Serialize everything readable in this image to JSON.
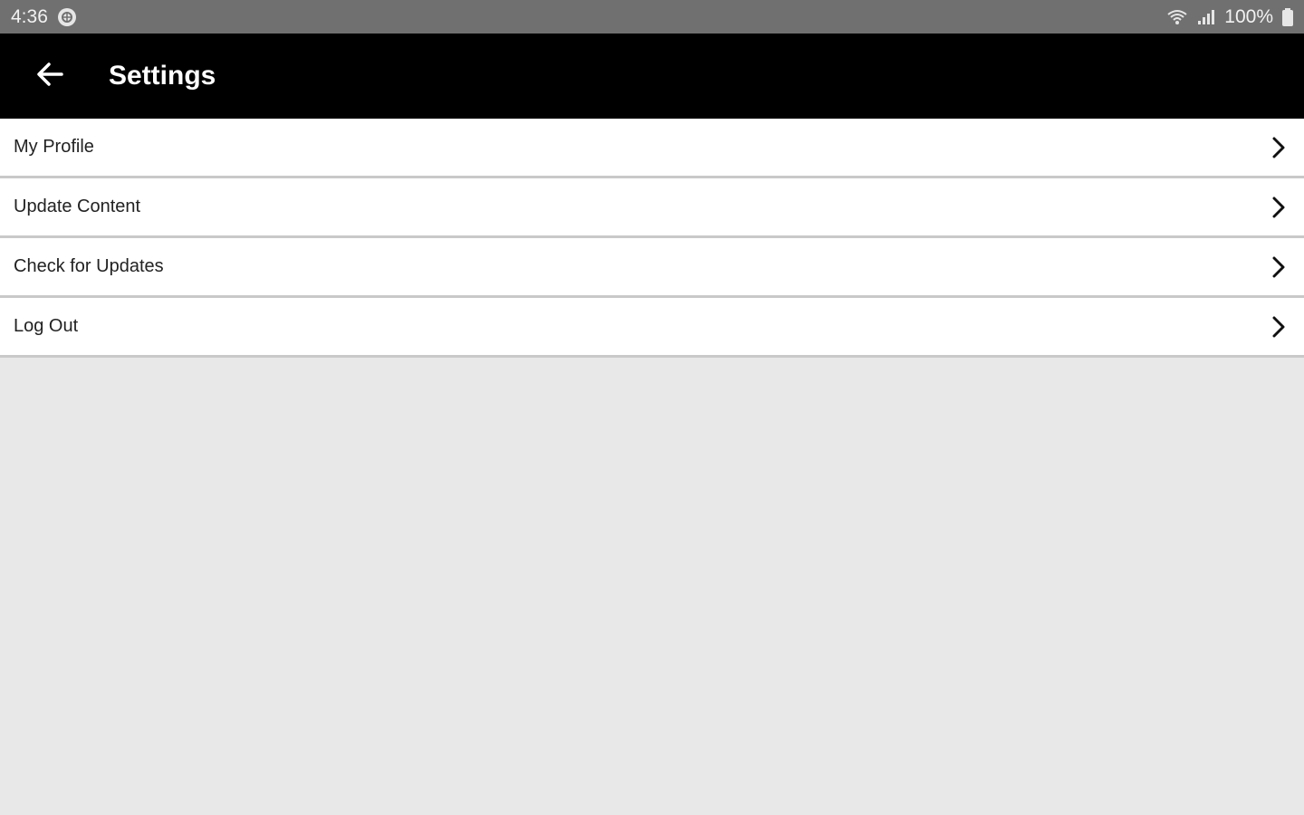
{
  "status_bar": {
    "time": "4:36",
    "battery": "100%",
    "icons": [
      "notification-icon",
      "wifi-icon",
      "signal-icon",
      "battery-icon"
    ]
  },
  "app_bar": {
    "title": "Settings",
    "back_icon": "back-arrow-icon",
    "background": "#000000"
  },
  "settings": {
    "items": [
      {
        "label": "My Profile"
      },
      {
        "label": "Update Content"
      },
      {
        "label": "Check for Updates"
      },
      {
        "label": "Log Out"
      }
    ]
  },
  "colors": {
    "status_bar": "#707070",
    "page_background": "#e8e8e8",
    "divider": "#c9c9c9"
  }
}
